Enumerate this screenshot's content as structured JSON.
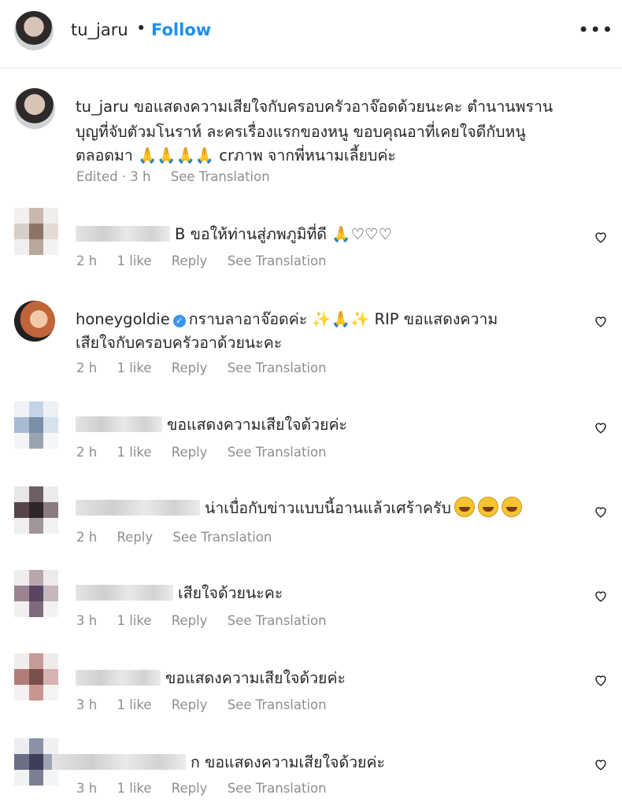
{
  "header": {
    "username": "tu_jaru",
    "separator": "•",
    "follow_label": "Follow",
    "more_label": "•••"
  },
  "caption": {
    "username": "tu_jaru",
    "line1": "ขอแสดงความเสียใจกับครอบครัวอาจ๊อดด้วยนะคะ ตำนานพราน",
    "line2": "บุญที่จับตัวมโนราห์ ละครเรื่องแรกของหนู ขอบคุณอาที่เคยใจดีกับหนู",
    "line3": "ตลอดมา 🙏🙏🙏🙏 crภาพ จากพี่หนามเลี้ยบค่ะ",
    "time": "Edited · 3 h",
    "see_translation": "See Translation"
  },
  "comments": [
    {
      "username": "",
      "line1": "B ขอให้ท่านสู่ภพภูมิที่ดี 🙏♡♡♡",
      "line2": "",
      "time": "2 h",
      "likes": "1 like",
      "reply": "Reply",
      "see_translation": "See Translation"
    },
    {
      "username": "honeygoldie",
      "verified": true,
      "line1": "กราบลาอาจ๊อดค่ะ ✨🙏✨ RIP ขอแสดงความ",
      "line2": "เสียใจกับครอบครัวอาด้วยนะคะ",
      "time": "2 h",
      "likes": "1 like",
      "reply": "Reply",
      "see_translation": "See Translation"
    },
    {
      "username": "",
      "line1": "ขอแสดงความเสียใจด้วยค่ะ",
      "line2": "",
      "time": "2 h",
      "likes": "1 like",
      "reply": "Reply",
      "see_translation": "See Translation"
    },
    {
      "username": "",
      "line1": "น่าเบื่อกับข่าวแบบนี้อานแล้วเศร้าครับ",
      "line2": "",
      "time": "2 h",
      "likes": "",
      "reply": "Reply",
      "see_translation": "See Translation"
    },
    {
      "username": "",
      "line1": "เสียใจด้วยนะคะ",
      "line2": "",
      "time": "3 h",
      "likes": "1 like",
      "reply": "Reply",
      "see_translation": "See Translation"
    },
    {
      "username": "",
      "line1": "ขอแสดงความเสียใจด้วยค่ะ",
      "line2": "",
      "time": "3 h",
      "likes": "1 like",
      "reply": "Reply",
      "see_translation": "See Translation"
    },
    {
      "username": "",
      "line1": "ก ขอแสดงความเสียใจด้วยค่ะ",
      "line2": "",
      "time": "3 h",
      "likes": "1 like",
      "reply": "Reply",
      "see_translation": "See Translation"
    }
  ],
  "icons": {
    "heart": "heart-outline-icon",
    "verified": "verified-badge-icon",
    "more": "more-options-icon"
  },
  "colors": {
    "follow": "#1c8ff0",
    "meta_text": "#8e8e8e",
    "verified": "#3897f0"
  }
}
